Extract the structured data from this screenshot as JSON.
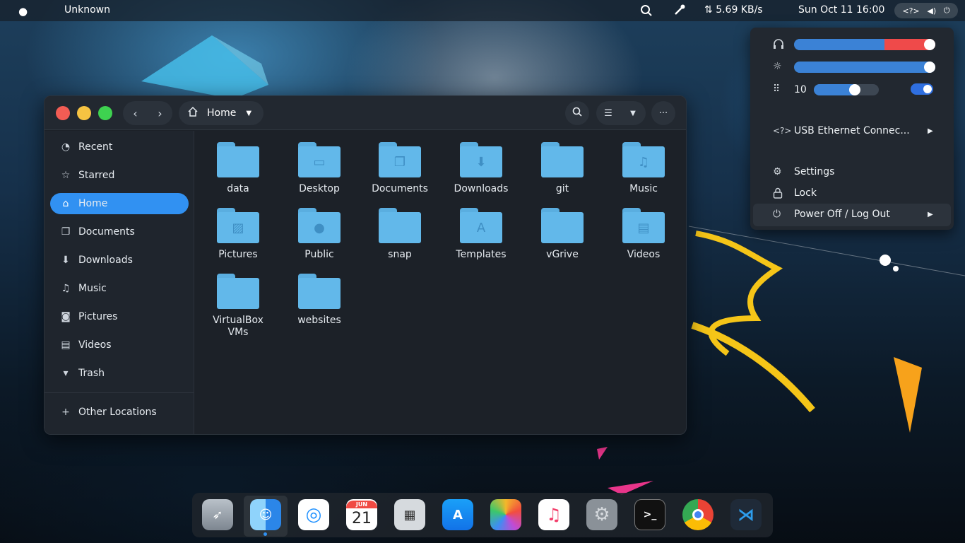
{
  "topbar": {
    "app_name": "Unknown",
    "net_speed": "5.69 KB/s",
    "clock": "Sun Oct 11  16:00",
    "status_code_icon": "<?>"
  },
  "file_manager": {
    "path_label": "Home",
    "sidebar": [
      {
        "label": "Recent",
        "icon": "clock-icon"
      },
      {
        "label": "Starred",
        "icon": "star-icon"
      },
      {
        "label": "Home",
        "icon": "home-icon",
        "active": true
      },
      {
        "label": "Documents",
        "icon": "document-icon"
      },
      {
        "label": "Downloads",
        "icon": "download-icon"
      },
      {
        "label": "Music",
        "icon": "music-icon"
      },
      {
        "label": "Pictures",
        "icon": "camera-icon"
      },
      {
        "label": "Videos",
        "icon": "film-icon"
      },
      {
        "label": "Trash",
        "icon": "trash-icon"
      },
      {
        "label": "Other Locations",
        "icon": "plus-icon"
      }
    ],
    "folders": [
      {
        "name": "data"
      },
      {
        "name": "Desktop"
      },
      {
        "name": "Documents"
      },
      {
        "name": "Downloads"
      },
      {
        "name": "git"
      },
      {
        "name": "Music"
      },
      {
        "name": "Pictures"
      },
      {
        "name": "Public"
      },
      {
        "name": "snap"
      },
      {
        "name": "Templates"
      },
      {
        "name": "vGrive"
      },
      {
        "name": "Videos"
      },
      {
        "name": "VirtualBox VMs"
      },
      {
        "name": "websites"
      }
    ]
  },
  "system_menu": {
    "volume_level": 1.0,
    "brightness_level": 1.0,
    "workspace_count": "10",
    "workspace_slider_level": 0.63,
    "network_label": "USB Ethernet Connec...",
    "settings_label": "Settings",
    "lock_label": "Lock",
    "power_label": "Power Off / Log Out"
  },
  "dock": {
    "calendar_month": "JUN",
    "calendar_day": "21",
    "apps": [
      "launchpad",
      "finder",
      "safari",
      "calendar",
      "calculator",
      "app-store",
      "photos",
      "music",
      "system-preferences",
      "terminal",
      "chrome",
      "vscode"
    ]
  },
  "colors": {
    "accent": "#3191f2",
    "folder": "#62b8ea",
    "window_bg": "#1c2128",
    "close": "#f25c54",
    "minimize": "#f6c342",
    "maximize": "#3ed250"
  }
}
